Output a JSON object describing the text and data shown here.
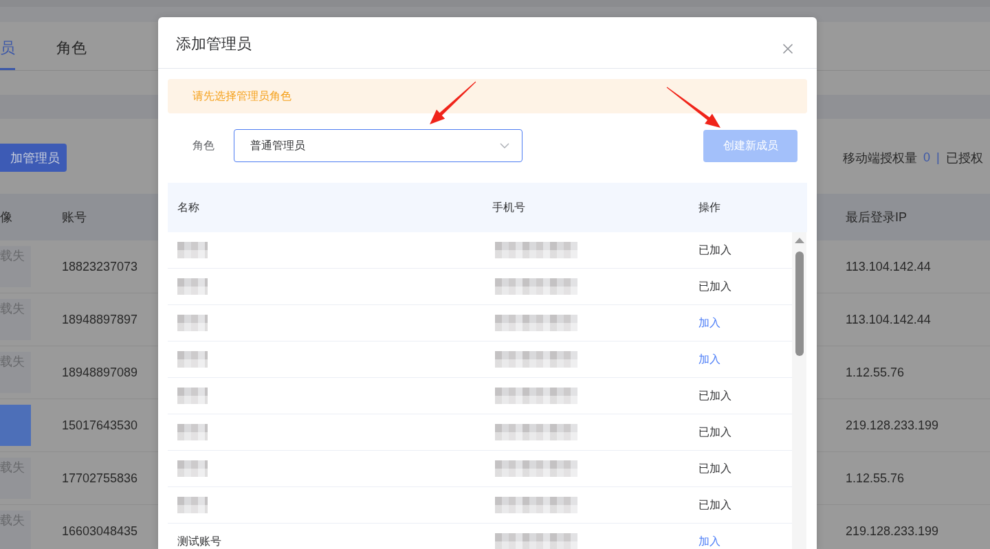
{
  "background_page": {
    "tabs": [
      {
        "label": "员",
        "selected": true
      },
      {
        "label": "角色",
        "selected": false
      }
    ],
    "add_button": {
      "label": "加管理员"
    },
    "license": {
      "label": "移动端授权量",
      "count": "0",
      "separator": "|",
      "authorized_label": "已授权"
    },
    "table": {
      "columns": [
        "像",
        "账号",
        "最后登录IP"
      ],
      "rows": [
        {
          "avatar": {
            "kind": "broken",
            "text": "载失"
          },
          "account": "18823237073",
          "last_ip": "113.104.142.44"
        },
        {
          "avatar": {
            "kind": "broken",
            "text": "载失"
          },
          "account": "18948897897",
          "last_ip": "113.104.142.44"
        },
        {
          "avatar": {
            "kind": "broken",
            "text": "载失"
          },
          "account": "18948897089",
          "last_ip": "1.12.55.76"
        },
        {
          "avatar": {
            "kind": "photo"
          },
          "account": "15017643530",
          "last_ip": "219.128.233.199"
        },
        {
          "avatar": {
            "kind": "broken",
            "text": "载失"
          },
          "account": "17702755836",
          "last_ip": "1.12.55.76"
        },
        {
          "avatar": {
            "kind": "broken",
            "text": "载失"
          },
          "account": "16603048435",
          "last_ip": "219.128.233.199"
        }
      ]
    }
  },
  "dialog": {
    "title": "添加管理员",
    "alert": "请先选择管理员角色",
    "role": {
      "label": "角色",
      "value": "普通管理员",
      "focused": true
    },
    "create_button": {
      "label": "创建新成员",
      "disabled": true
    },
    "table": {
      "columns": [
        "名称",
        "手机号",
        "操作"
      ],
      "rows": [
        {
          "name": {
            "pixelated": true
          },
          "phone": {
            "pixelated": true
          },
          "action": {
            "label": "已加入",
            "joined": true
          }
        },
        {
          "name": {
            "pixelated": true
          },
          "phone": {
            "pixelated": true
          },
          "action": {
            "label": "已加入",
            "joined": true
          }
        },
        {
          "name": {
            "pixelated": true
          },
          "phone": {
            "pixelated": true
          },
          "action": {
            "label": "加入",
            "joined": false
          }
        },
        {
          "name": {
            "pixelated": true
          },
          "phone": {
            "pixelated": true
          },
          "action": {
            "label": "加入",
            "joined": false
          }
        },
        {
          "name": {
            "pixelated": true
          },
          "phone": {
            "pixelated": true
          },
          "action": {
            "label": "已加入",
            "joined": true
          }
        },
        {
          "name": {
            "pixelated": true
          },
          "phone": {
            "pixelated": true
          },
          "action": {
            "label": "已加入",
            "joined": true
          }
        },
        {
          "name": {
            "pixelated": true
          },
          "phone": {
            "pixelated": true
          },
          "action": {
            "label": "已加入",
            "joined": true
          }
        },
        {
          "name": {
            "pixelated": true
          },
          "phone": {
            "pixelated": true
          },
          "action": {
            "label": "已加入",
            "joined": true
          }
        },
        {
          "name": {
            "pixelated": false,
            "text": "测试账号"
          },
          "phone": {
            "pixelated": true
          },
          "action": {
            "label": "加入",
            "joined": false
          }
        }
      ]
    }
  }
}
